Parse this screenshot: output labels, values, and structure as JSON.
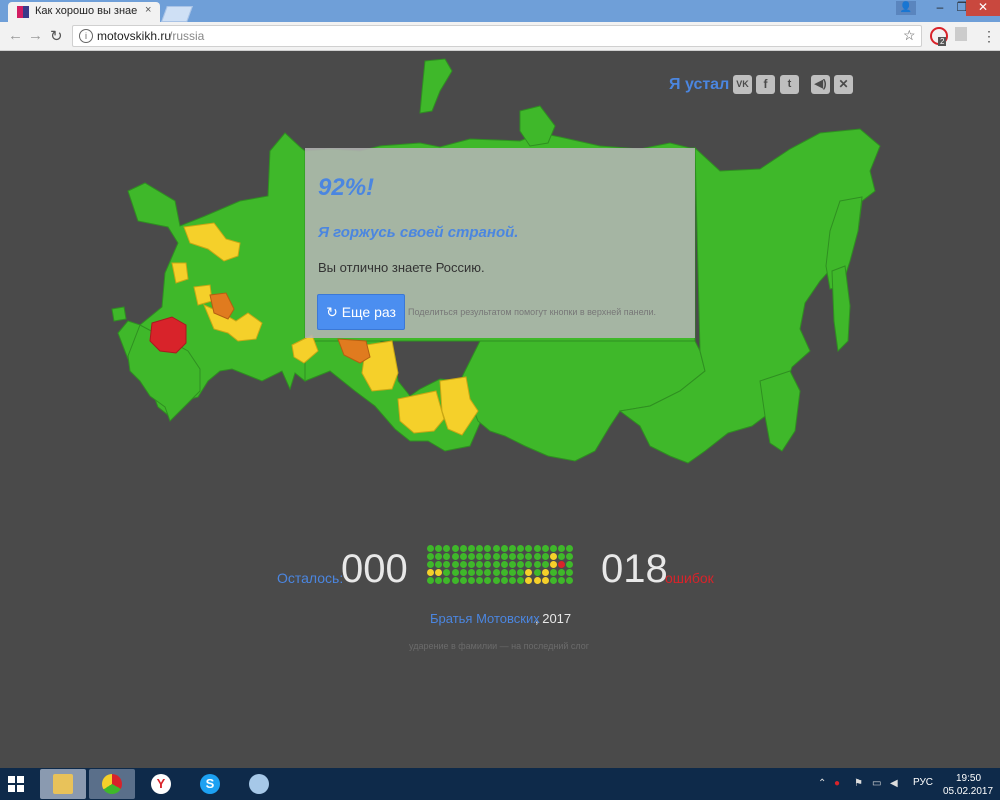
{
  "browser": {
    "tab_title": "Как хорошо вы знаете Р",
    "tab_close": "×",
    "url_host": "motovskikh.ru",
    "url_path": "/russia",
    "window_buttons": {
      "user": "👤",
      "minimize": "–",
      "maximize": "❐",
      "close": "✕"
    },
    "nav": {
      "back": "←",
      "forward": "→",
      "reload": "↻",
      "info": "i",
      "star": "☆",
      "menu": "⋮"
    },
    "extension_badge": "2"
  },
  "header": {
    "tired_label": "Я устал",
    "social": {
      "vk": "VK",
      "facebook": "f",
      "twitter": "t"
    },
    "sound_icon": "◀)",
    "close_icon": "✕"
  },
  "result": {
    "percent": "92%!",
    "proud": "Я горжусь своей страной.",
    "text": "Вы отлично знаете Россию.",
    "retry_label": "↻ Еще раз",
    "share_hint": "Поделиться результатом помогут кнопки в верхней панели."
  },
  "stats": {
    "remaining_label": "Осталось:",
    "remaining_count": "000",
    "errors_count": "018",
    "errors_label": "ошибок",
    "answers": [
      "g",
      "g",
      "g",
      "g",
      "g",
      "g",
      "g",
      "g",
      "g",
      "g",
      "g",
      "g",
      "g",
      "g",
      "g",
      "g",
      "g",
      "g",
      "g",
      "g",
      "g",
      "g",
      "g",
      "g",
      "g",
      "g",
      "g",
      "g",
      "g",
      "g",
      "g",
      "g",
      "g",
      "y",
      "g",
      "g",
      "g",
      "g",
      "g",
      "g",
      "g",
      "g",
      "g",
      "g",
      "g",
      "g",
      "g",
      "g",
      "g",
      "g",
      "g",
      "y",
      "r",
      "g",
      "y",
      "y",
      "g",
      "g",
      "g",
      "g",
      "g",
      "g",
      "g",
      "g",
      "g",
      "g",
      "y",
      "g",
      "y",
      "g",
      "g",
      "g",
      "g",
      "g",
      "g",
      "g",
      "g",
      "g",
      "g",
      "g",
      "g",
      "g",
      "g",
      "g",
      "y",
      "y",
      "y",
      "g",
      "g",
      "g"
    ],
    "dot_colors": {
      "g": "#3fb82a",
      "y": "#f5d02a",
      "r": "#d8232a",
      "o": "#e07b1f"
    }
  },
  "credits": {
    "authors": "Братья Мотовских",
    "year": ", 2017",
    "stress_note": "ударение в фамилии — на последний слог"
  },
  "taskbar": {
    "lang": "РУС",
    "time": "19:50",
    "date": "05.02.2017"
  },
  "colors": {
    "map_green": "#3fb82a",
    "map_yellow": "#f5d02a",
    "map_orange": "#e07b1f",
    "map_red": "#d8232a",
    "accent_blue": "#4b86e0"
  }
}
